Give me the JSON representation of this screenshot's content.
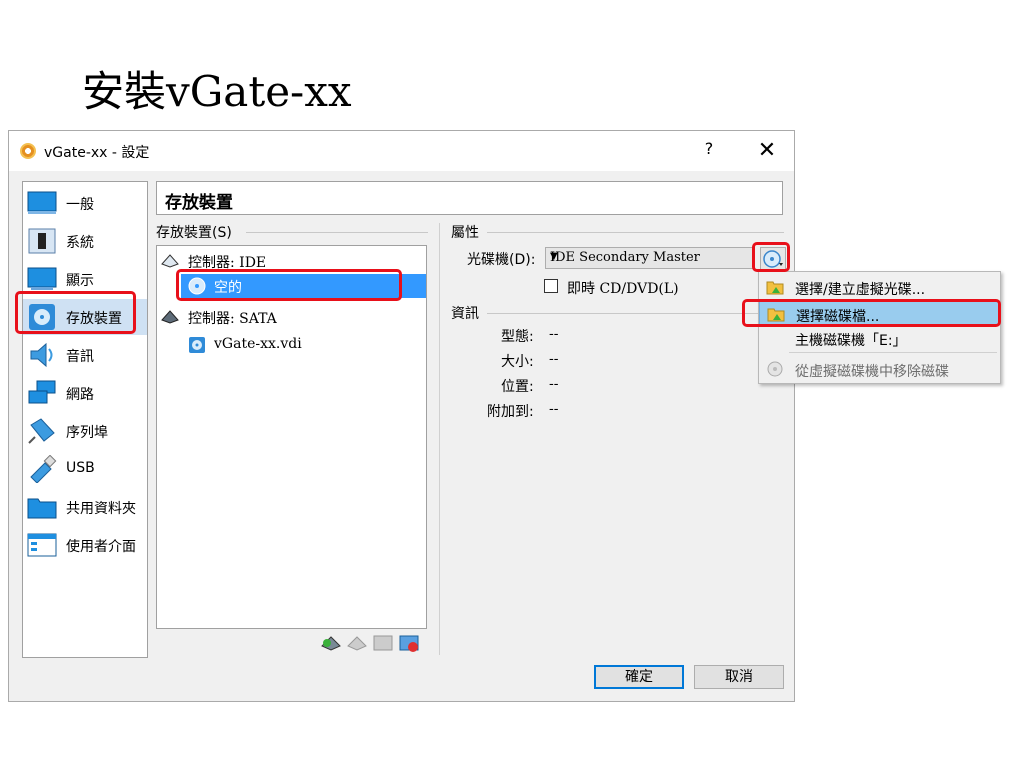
{
  "slide": {
    "title": "安裝vGate-xx"
  },
  "window": {
    "title": "vGate-xx - 設定",
    "help": "?",
    "close": "✕"
  },
  "sidebar": {
    "items": [
      {
        "label": "一般",
        "icon": "general-icon"
      },
      {
        "label": "系統",
        "icon": "system-icon"
      },
      {
        "label": "顯示",
        "icon": "display-icon"
      },
      {
        "label": "存放裝置",
        "icon": "storage-icon",
        "selected": true
      },
      {
        "label": "音訊",
        "icon": "audio-icon"
      },
      {
        "label": "網路",
        "icon": "network-icon"
      },
      {
        "label": "序列埠",
        "icon": "serial-port-icon"
      },
      {
        "label": "USB",
        "icon": "usb-icon"
      },
      {
        "label": "共用資料夾",
        "icon": "shared-folder-icon"
      },
      {
        "label": "使用者介面",
        "icon": "user-interface-icon"
      }
    ]
  },
  "page": {
    "title": "存放裝置"
  },
  "storage": {
    "group_label": "存放裝置(S)",
    "tree": [
      {
        "label": "控制器: IDE",
        "type": "controller"
      },
      {
        "label": "空的",
        "type": "disc",
        "selected": true
      },
      {
        "label": "控制器: SATA",
        "type": "controller"
      },
      {
        "label": "vGate-xx.vdi",
        "type": "disk"
      }
    ]
  },
  "attributes": {
    "group_label": "屬性",
    "drive_label": "光碟機(D):",
    "drive_value": "IDE Secondary Master",
    "live_cd_label": "即時 CD/DVD(L)"
  },
  "info": {
    "group_label": "資訊",
    "rows": [
      {
        "label": "型態:",
        "value": "--"
      },
      {
        "label": "大小:",
        "value": "--"
      },
      {
        "label": "位置:",
        "value": "--"
      },
      {
        "label": "附加到:",
        "value": "--"
      }
    ]
  },
  "buttons": {
    "ok": "確定",
    "cancel": "取消"
  },
  "menu": {
    "items": [
      {
        "label": "選擇/建立虛擬光碟...",
        "icon": "folder-disc-icon"
      },
      {
        "label": "選擇磁碟檔...",
        "icon": "folder-disc-icon",
        "hover": true
      },
      {
        "label": "主機磁碟機「E:」",
        "icon": ""
      },
      {
        "label": "從虛擬磁碟機中移除磁碟",
        "icon": "remove-disc-icon",
        "disabled": true
      }
    ]
  },
  "colors": {
    "highlight_red": "#e8101a",
    "selection_blue": "#3399ff",
    "menu_hover": "#99ccee"
  }
}
